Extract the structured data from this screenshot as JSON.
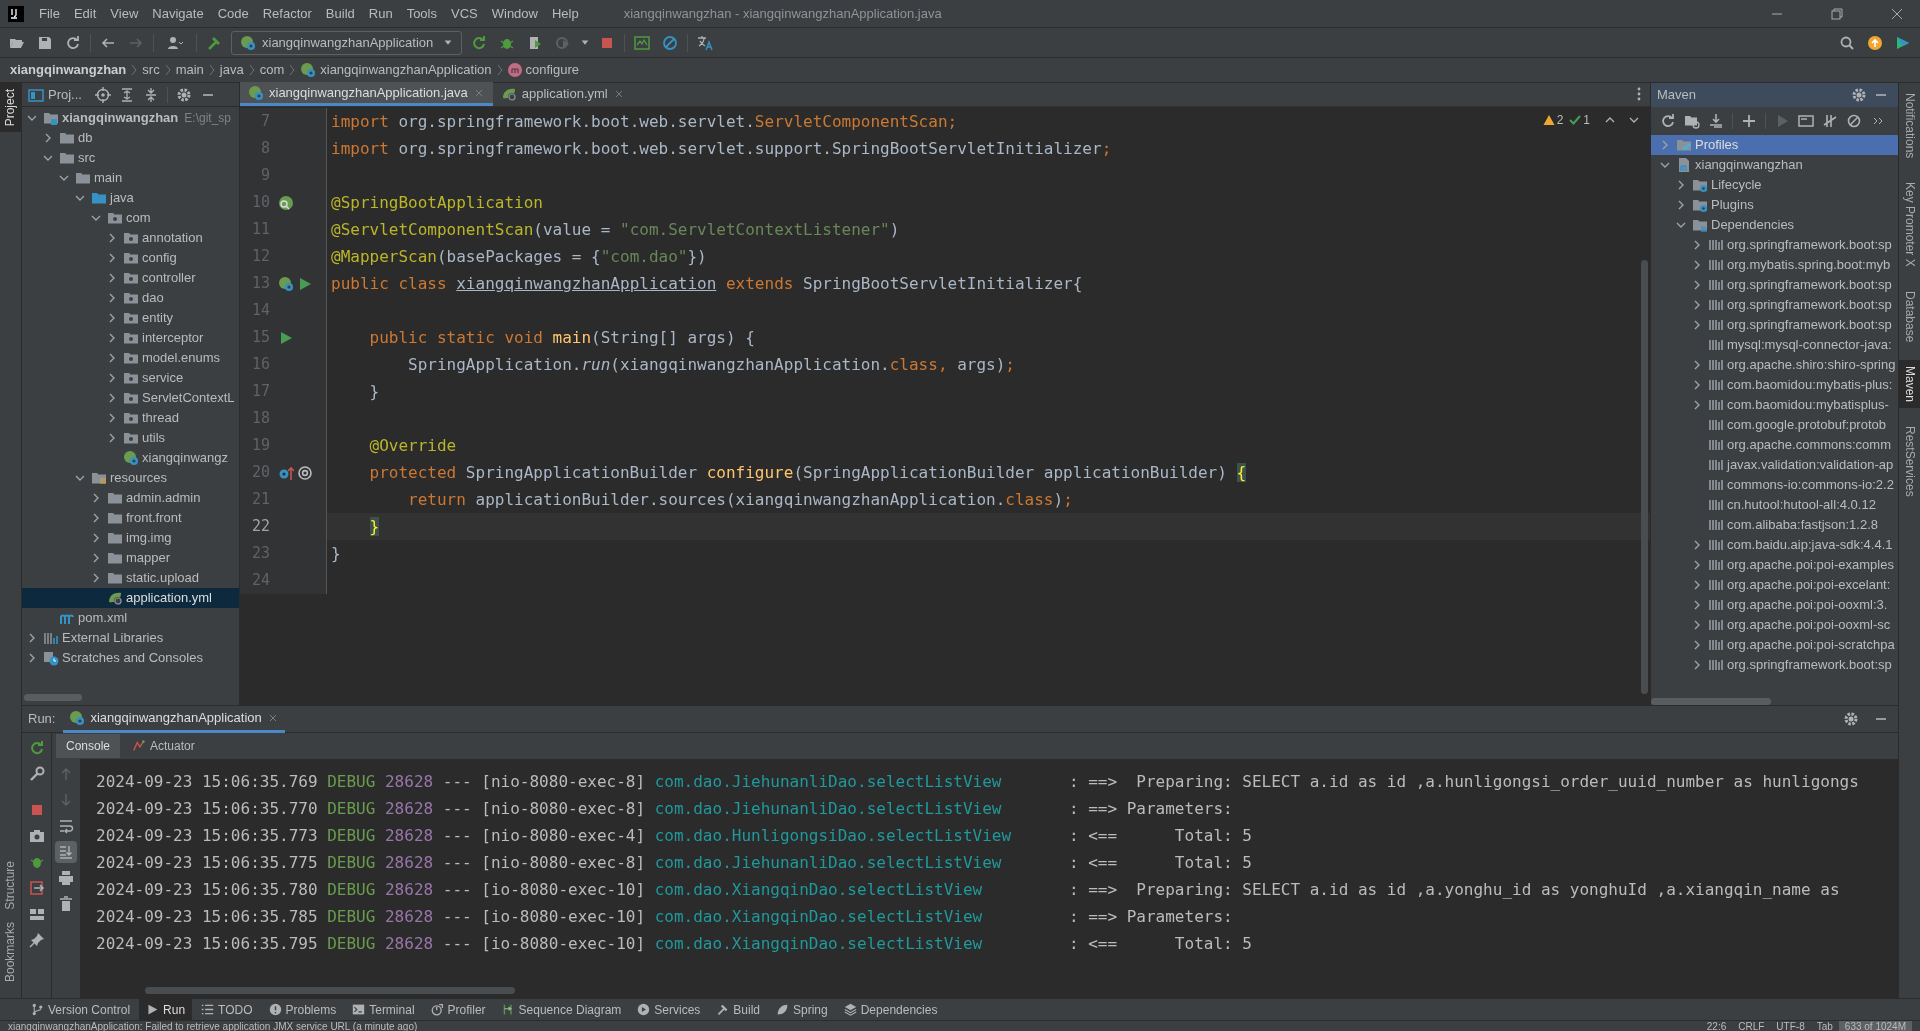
{
  "window": {
    "title": "xiangqinwangzhan - xiangqinwangzhanApplication.java"
  },
  "menu": [
    "File",
    "Edit",
    "View",
    "Navigate",
    "Code",
    "Refactor",
    "Build",
    "Run",
    "Tools",
    "VCS",
    "Window",
    "Help"
  ],
  "toolbar": {
    "run_config": "xiangqinwangzhanApplication"
  },
  "breadcrumb": [
    {
      "label": "xiangqinwangzhan",
      "kind": "project"
    },
    {
      "label": "src",
      "kind": "folder"
    },
    {
      "label": "main",
      "kind": "folder"
    },
    {
      "label": "java",
      "kind": "folder"
    },
    {
      "label": "com",
      "kind": "folder"
    },
    {
      "label": "xiangqinwangzhanApplication",
      "kind": "class"
    },
    {
      "label": "configure",
      "kind": "method"
    }
  ],
  "left_stripe": {
    "top": [
      {
        "label": "Project",
        "selected": true
      }
    ],
    "bottom": [
      {
        "label": "Structure",
        "selected": false
      },
      {
        "label": "Bookmarks",
        "selected": false
      }
    ]
  },
  "right_stripe": [
    {
      "label": "Notifications",
      "selected": false
    },
    {
      "label": "Key Promoter X",
      "selected": false
    },
    {
      "label": "Database",
      "selected": false
    },
    {
      "label": "Maven",
      "selected": true
    },
    {
      "label": "RestServices",
      "selected": false
    }
  ],
  "project": {
    "title": "Proj...",
    "tree": [
      {
        "label": "xiangqinwangzhan",
        "path": "E:\\git_sp",
        "kind": "module",
        "expanded": true,
        "selected": false,
        "children": [
          {
            "label": "db",
            "kind": "folder",
            "expanded": false,
            "selected": false
          },
          {
            "label": "src",
            "kind": "folder",
            "expanded": true,
            "selected": false,
            "children": [
              {
                "label": "main",
                "kind": "folder",
                "expanded": true,
                "selected": false,
                "children": [
                  {
                    "label": "java",
                    "kind": "source_root",
                    "expanded": true,
                    "selected": false,
                    "children": [
                      {
                        "label": "com",
                        "kind": "package",
                        "expanded": true,
                        "selected": false,
                        "children": [
                          {
                            "label": "annotation",
                            "kind": "package",
                            "expanded": false,
                            "selected": false
                          },
                          {
                            "label": "config",
                            "kind": "package",
                            "expanded": false,
                            "selected": false
                          },
                          {
                            "label": "controller",
                            "kind": "package",
                            "expanded": false,
                            "selected": false
                          },
                          {
                            "label": "dao",
                            "kind": "package",
                            "expanded": false,
                            "selected": false
                          },
                          {
                            "label": "entity",
                            "kind": "package",
                            "expanded": false,
                            "selected": false
                          },
                          {
                            "label": "interceptor",
                            "kind": "package",
                            "expanded": false,
                            "selected": false
                          },
                          {
                            "label": "model.enums",
                            "kind": "package",
                            "expanded": false,
                            "selected": false
                          },
                          {
                            "label": "service",
                            "kind": "package",
                            "expanded": false,
                            "selected": false
                          },
                          {
                            "label": "ServletContextL",
                            "kind": "package",
                            "expanded": false,
                            "selected": false
                          },
                          {
                            "label": "thread",
                            "kind": "package",
                            "expanded": false,
                            "selected": false
                          },
                          {
                            "label": "utils",
                            "kind": "package",
                            "expanded": false,
                            "selected": false
                          },
                          {
                            "label": "xiangqinwangz",
                            "kind": "spring_class",
                            "selected": false
                          }
                        ]
                      }
                    ]
                  },
                  {
                    "label": "resources",
                    "kind": "resources",
                    "expanded": true,
                    "selected": false,
                    "children": [
                      {
                        "label": "admin.admin",
                        "kind": "folder",
                        "expanded": false,
                        "selected": false
                      },
                      {
                        "label": "front.front",
                        "kind": "folder",
                        "expanded": false,
                        "selected": false
                      },
                      {
                        "label": "img.img",
                        "kind": "folder",
                        "expanded": false,
                        "selected": false
                      },
                      {
                        "label": "mapper",
                        "kind": "folder",
                        "expanded": false,
                        "selected": false
                      },
                      {
                        "label": "static.upload",
                        "kind": "folder",
                        "expanded": false,
                        "selected": false
                      },
                      {
                        "label": "application.yml",
                        "kind": "yml",
                        "selected": true
                      }
                    ]
                  }
                ]
              }
            ]
          },
          {
            "label": "pom.xml",
            "kind": "pom",
            "selected": false
          }
        ]
      },
      {
        "label": "External Libraries",
        "kind": "libraries",
        "expanded": false,
        "selected": false
      },
      {
        "label": "Scratches and Consoles",
        "kind": "scratches",
        "expanded": false,
        "selected": false
      }
    ]
  },
  "editor": {
    "tabs": [
      {
        "label": "xiangqinwangzhanApplication.java",
        "kind": "spring_class",
        "selected": true
      },
      {
        "label": "application.yml",
        "kind": "yml",
        "selected": false
      }
    ],
    "inspections": {
      "warnings": "2",
      "passed": "1"
    },
    "lines": [
      {
        "number": "7",
        "selected": false,
        "tokens": [
          {
            "kind": "keyword",
            "text": "import "
          },
          {
            "kind": "plain",
            "text": "org.springframework.boot.web.servlet."
          },
          {
            "kind": "keyword",
            "text": "ServletComponentScan;"
          }
        ]
      },
      {
        "number": "8",
        "selected": false,
        "tokens": [
          {
            "kind": "keyword",
            "text": "import "
          },
          {
            "kind": "plain",
            "text": "org.springframework.boot.web.servlet.support.SpringBootServletInitializer"
          },
          {
            "kind": "keyword",
            "text": ";"
          }
        ]
      },
      {
        "number": "9",
        "selected": false
      },
      {
        "number": "10",
        "selected": false,
        "tokens": [
          {
            "kind": "annotation",
            "text": "@SpringBootApplication"
          }
        ]
      },
      {
        "number": "11",
        "selected": false,
        "tokens": [
          {
            "kind": "annotation",
            "text": "@ServletComponentScan"
          },
          {
            "kind": "plain",
            "text": "(value = "
          },
          {
            "kind": "string",
            "text": "\"com.ServletContextListener\""
          },
          {
            "kind": "plain",
            "text": ")"
          }
        ]
      },
      {
        "number": "12",
        "selected": false,
        "tokens": [
          {
            "kind": "annotation",
            "text": "@MapperScan"
          },
          {
            "kind": "plain",
            "text": "(basePackages = {"
          },
          {
            "kind": "string",
            "text": "\"com.dao\""
          },
          {
            "kind": "plain",
            "text": "})"
          }
        ]
      },
      {
        "number": "13",
        "selected": false,
        "tokens": [
          {
            "kind": "keyword",
            "text": "public class "
          },
          {
            "kind": "declared_class",
            "text": "xiangqinwangzhanApplication"
          },
          {
            "kind": "keyword",
            "text": " extends "
          },
          {
            "kind": "plain",
            "text": "SpringBootServletInitializer{"
          }
        ]
      },
      {
        "number": "14",
        "selected": false
      },
      {
        "number": "15",
        "selected": false,
        "tokens": [
          {
            "kind": "keyword",
            "text": "    public static void "
          },
          {
            "kind": "method",
            "text": "main"
          },
          {
            "kind": "plain",
            "text": "(String[] args) {"
          }
        ]
      },
      {
        "number": "16",
        "selected": false,
        "tokens": [
          {
            "kind": "plain",
            "text": "        SpringApplication."
          },
          {
            "kind": "static_call",
            "text": "run"
          },
          {
            "kind": "plain",
            "text": "(xiangqinwangzhanApplication."
          },
          {
            "kind": "keyword",
            "text": "class, "
          },
          {
            "kind": "plain",
            "text": "args)"
          },
          {
            "kind": "keyword",
            "text": ";"
          }
        ]
      },
      {
        "number": "17",
        "selected": false,
        "tokens": [
          {
            "kind": "plain",
            "text": "    }"
          }
        ]
      },
      {
        "number": "18",
        "selected": false
      },
      {
        "number": "19",
        "selected": false,
        "tokens": [
          {
            "kind": "annotation",
            "text": "    @Override"
          }
        ]
      },
      {
        "number": "20",
        "selected": false,
        "tokens": [
          {
            "kind": "keyword",
            "text": "    protected "
          },
          {
            "kind": "plain",
            "text": "SpringApplicationBuilder "
          },
          {
            "kind": "method",
            "text": "configure"
          },
          {
            "kind": "plain",
            "text": "(SpringApplicationBuilder applicationBuilder) "
          },
          {
            "kind": "brace_match",
            "text": "{"
          }
        ]
      },
      {
        "number": "21",
        "selected": false,
        "tokens": [
          {
            "kind": "keyword",
            "text": "        return "
          },
          {
            "kind": "plain",
            "text": "applicationBuilder.sources(xiangqinwangzhanApplication."
          },
          {
            "kind": "keyword",
            "text": "class"
          },
          {
            "kind": "plain",
            "text": ")"
          },
          {
            "kind": "keyword",
            "text": ";"
          }
        ]
      },
      {
        "number": "22",
        "selected": true,
        "tokens": [
          {
            "kind": "brace_match",
            "text": "    }"
          }
        ]
      },
      {
        "number": "23",
        "selected": false,
        "tokens": [
          {
            "kind": "plain",
            "text": "}"
          }
        ]
      },
      {
        "number": "24",
        "selected": false
      }
    ]
  },
  "maven": {
    "title": "Maven",
    "tree": [
      {
        "label": "Profiles",
        "kind": "profiles",
        "expanded": false,
        "selected": true
      },
      {
        "label": "xiangqinwangzhan",
        "kind": "maven_project",
        "expanded": true,
        "selected": false,
        "children": [
          {
            "label": "Lifecycle",
            "kind": "lifecycle",
            "expanded": false,
            "selected": false
          },
          {
            "label": "Plugins",
            "kind": "lifecycle",
            "expanded": false,
            "selected": false
          },
          {
            "label": "Dependencies",
            "kind": "dependencies",
            "expanded": true,
            "selected": false,
            "children": [
              {
                "label": "org.springframework.boot:sp",
                "kind": "library",
                "expanded": false,
                "selected": false
              },
              {
                "label": "org.mybatis.spring.boot:myb",
                "kind": "library",
                "expanded": false,
                "selected": false
              },
              {
                "label": "org.springframework.boot:sp",
                "kind": "library",
                "expanded": false,
                "selected": false
              },
              {
                "label": "org.springframework.boot:sp",
                "kind": "library",
                "expanded": false,
                "selected": false
              },
              {
                "label": "org.springframework.boot:sp",
                "kind": "library",
                "expanded": false,
                "selected": false
              },
              {
                "label": "mysql:mysql-connector-java:",
                "kind": "library",
                "selected": false
              },
              {
                "label": "org.apache.shiro:shiro-spring",
                "kind": "library",
                "expanded": false,
                "selected": false
              },
              {
                "label": "com.baomidou:mybatis-plus:",
                "kind": "library",
                "expanded": false,
                "selected": false
              },
              {
                "label": "com.baomidou:mybatisplus-",
                "kind": "library",
                "expanded": false,
                "selected": false
              },
              {
                "label": "com.google.protobuf:protob",
                "kind": "library",
                "selected": false
              },
              {
                "label": "org.apache.commons:comm",
                "kind": "library",
                "selected": false
              },
              {
                "label": "javax.validation:validation-ap",
                "kind": "library",
                "selected": false
              },
              {
                "label": "commons-io:commons-io:2.2",
                "kind": "library",
                "selected": false
              },
              {
                "label": "cn.hutool:hutool-all:4.0.12",
                "kind": "library",
                "selected": false
              },
              {
                "label": "com.alibaba:fastjson:1.2.8",
                "kind": "library",
                "selected": false
              },
              {
                "label": "com.baidu.aip:java-sdk:4.4.1",
                "kind": "library",
                "expanded": false,
                "selected": false
              },
              {
                "label": "org.apache.poi:poi-examples",
                "kind": "library",
                "expanded": false,
                "selected": false
              },
              {
                "label": "org.apache.poi:poi-excelant:",
                "kind": "library",
                "expanded": false,
                "selected": false
              },
              {
                "label": "org.apache.poi:poi-ooxml:3.",
                "kind": "library",
                "expanded": false,
                "selected": false
              },
              {
                "label": "org.apache.poi:poi-ooxml-sc",
                "kind": "library",
                "expanded": false,
                "selected": false
              },
              {
                "label": "org.apache.poi:poi-scratchpa",
                "kind": "library",
                "expanded": false,
                "selected": false
              },
              {
                "label": "org.springframework.boot:sp",
                "kind": "library",
                "expanded": false,
                "selected": false
              }
            ]
          }
        ]
      }
    ]
  },
  "run": {
    "label": "Run:",
    "tab": "xiangqinwangzhanApplication",
    "subtabs": [
      {
        "label": "Console",
        "selected": true
      },
      {
        "label": "Actuator",
        "selected": false
      }
    ],
    "log": [
      {
        "time": "2024-09-23 15:06:35.769",
        "level": "DEBUG",
        "pid": "28628",
        "separator": "---",
        "thread": "[nio-8080-exec-8]",
        "logger": "com.dao.JiehunanliDao.selectListView",
        "message": ": ==>  Preparing: SELECT a.id as id ,a.hunligongsi_order_uuid_number as hunligongs"
      },
      {
        "time": "2024-09-23 15:06:35.770",
        "level": "DEBUG",
        "pid": "28628",
        "separator": "---",
        "thread": "[nio-8080-exec-8]",
        "logger": "com.dao.JiehunanliDao.selectListView",
        "message": ": ==> Parameters:"
      },
      {
        "time": "2024-09-23 15:06:35.773",
        "level": "DEBUG",
        "pid": "28628",
        "separator": "---",
        "thread": "[nio-8080-exec-4]",
        "logger": "com.dao.HunligongsiDao.selectListView",
        "message": ": <==      Total: 5"
      },
      {
        "time": "2024-09-23 15:06:35.775",
        "level": "DEBUG",
        "pid": "28628",
        "separator": "---",
        "thread": "[nio-8080-exec-8]",
        "logger": "com.dao.JiehunanliDao.selectListView",
        "message": ": <==      Total: 5"
      },
      {
        "time": "2024-09-23 15:06:35.780",
        "level": "DEBUG",
        "pid": "28628",
        "separator": "---",
        "thread": "[io-8080-exec-10]",
        "logger": "com.dao.XiangqinDao.selectListView",
        "message": ": ==>  Preparing: SELECT a.id as id ,a.yonghu_id as yonghuId ,a.xiangqin_name as"
      },
      {
        "time": "2024-09-23 15:06:35.785",
        "level": "DEBUG",
        "pid": "28628",
        "separator": "---",
        "thread": "[io-8080-exec-10]",
        "logger": "com.dao.XiangqinDao.selectListView",
        "message": ": ==> Parameters:"
      },
      {
        "time": "2024-09-23 15:06:35.795",
        "level": "DEBUG",
        "pid": "28628",
        "separator": "---",
        "thread": "[io-8080-exec-10]",
        "logger": "com.dao.XiangqinDao.selectListView",
        "message": ": <==      Total: 5"
      }
    ]
  },
  "tool_windows": [
    {
      "label": "Version Control",
      "kind": "vcs",
      "selected": false
    },
    {
      "label": "Run",
      "kind": "run",
      "selected": true
    },
    {
      "label": "TODO",
      "kind": "todo",
      "selected": false
    },
    {
      "label": "Problems",
      "kind": "problems",
      "selected": false
    },
    {
      "label": "Terminal",
      "kind": "terminal",
      "selected": false
    },
    {
      "label": "Profiler",
      "kind": "profiler",
      "selected": false
    },
    {
      "label": "Sequence Diagram",
      "kind": "sequence",
      "selected": false
    },
    {
      "label": "Services",
      "kind": "services",
      "selected": false
    },
    {
      "label": "Build",
      "kind": "build",
      "selected": false
    },
    {
      "label": "Spring",
      "kind": "spring",
      "selected": false
    },
    {
      "label": "Dependencies",
      "kind": "dependencies",
      "selected": false
    }
  ],
  "status_bar": {
    "message": "xiangqinwangzhanApplication: Failed to retrieve application JMX service URL (a minute ago)",
    "position": "22:6",
    "line_separator": "CRLF",
    "encoding": "UTF-8",
    "indent": "Tab",
    "memory": "633 of 1024M"
  }
}
